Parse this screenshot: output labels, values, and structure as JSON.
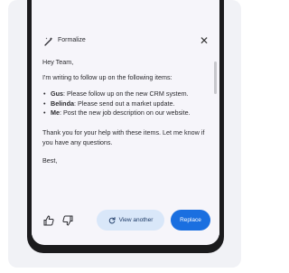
{
  "panel": {
    "title": "Formalize",
    "close_glyph": "✕",
    "wand_icon": "magic-wand-icon",
    "close_icon": "close-icon"
  },
  "email": {
    "greeting": "Hey Team,",
    "intro": "I'm writing to follow up on the following items:",
    "items": [
      {
        "name": "Gus",
        "text": ": Please follow up on the new CRM system."
      },
      {
        "name": "Belinda",
        "text": ": Please send out a market update."
      },
      {
        "name": "Me",
        "text": ": Post the new job description on our website."
      }
    ],
    "thanks": "Thank you for your help with these items. Let me know if you have any questions.",
    "signoff": "Best,"
  },
  "actions": {
    "thumbs_up_icon": "thumbs-up-icon",
    "thumbs_down_icon": "thumbs-down-icon",
    "refresh_icon": "refresh-icon",
    "view_another_label": "View another",
    "replace_label": "Replace"
  },
  "colors": {
    "accent": "#1a6fe0",
    "secondary_button": "#d9e7f9",
    "panel_bg": "#f6f5fa",
    "device_frame": "#1b1b1d"
  }
}
